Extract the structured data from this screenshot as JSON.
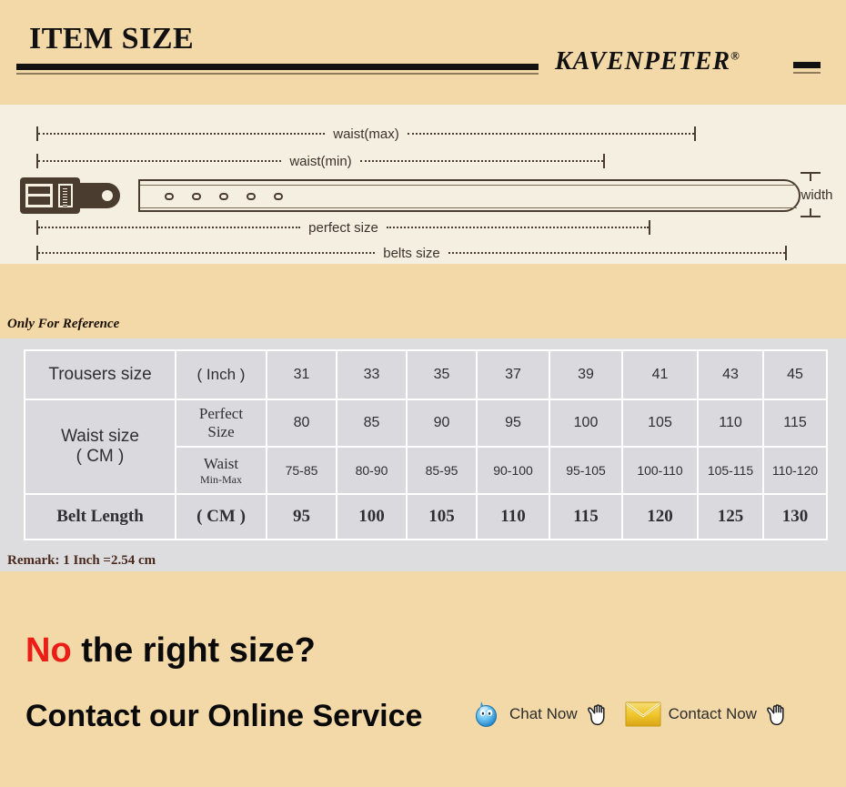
{
  "header": {
    "title": "ITEM SIZE",
    "brand": "KAVENPETER",
    "brand_mark": "®"
  },
  "diagram": {
    "labels": {
      "waist_max": "waist(max)",
      "waist_min": "waist(min)",
      "perfect_size": "perfect size",
      "belts_size": "belts size",
      "width": "width"
    },
    "holes": 5
  },
  "reference_note": "Only For Reference",
  "table": {
    "rows": [
      {
        "name": "trousers-size",
        "label": "Trousers size",
        "unit": "( Inch )",
        "values": [
          "31",
          "33",
          "35",
          "37",
          "39",
          "41",
          "43",
          "45"
        ]
      },
      {
        "name": "waist-perfect-size",
        "label": "Waist size\n( CM )",
        "label_line1": "Waist size",
        "label_line2": "( CM )",
        "unit": "Perfect\nSize",
        "unit_line1": "Perfect",
        "unit_line2": "Size",
        "values": [
          "80",
          "85",
          "90",
          "95",
          "100",
          "105",
          "110",
          "115"
        ]
      },
      {
        "name": "waist-min-max",
        "unit_line1": "Waist",
        "unit_line2": "Min-Max",
        "values": [
          "75-85",
          "80-90",
          "85-95",
          "90-100",
          "95-105",
          "100-110",
          "105-115",
          "110-120"
        ]
      },
      {
        "name": "belt-length",
        "label": "Belt Length",
        "unit": "( CM )",
        "values": [
          "95",
          "100",
          "105",
          "110",
          "115",
          "120",
          "125",
          "130"
        ]
      }
    ]
  },
  "remark": "Remark: 1 Inch =2.54 cm",
  "contact": {
    "question_highlight": "No",
    "question_rest": " the right size?",
    "cta": "Contact our Online Service",
    "buttons": [
      {
        "name": "chat-now",
        "label": "Chat Now",
        "icon": "chat-bubble-icon"
      },
      {
        "name": "contact-now",
        "label": "Contact Now",
        "icon": "envelope-icon"
      }
    ]
  },
  "colors": {
    "page_bg": "#f3d9a8",
    "diagram_bg": "#f5efe1",
    "table_bg": "#dddde0",
    "ink": "#4a3c2e",
    "accent_red": "#ec1c17",
    "envelope": "#edc32a",
    "chat_blue": "#3fa9e8"
  }
}
